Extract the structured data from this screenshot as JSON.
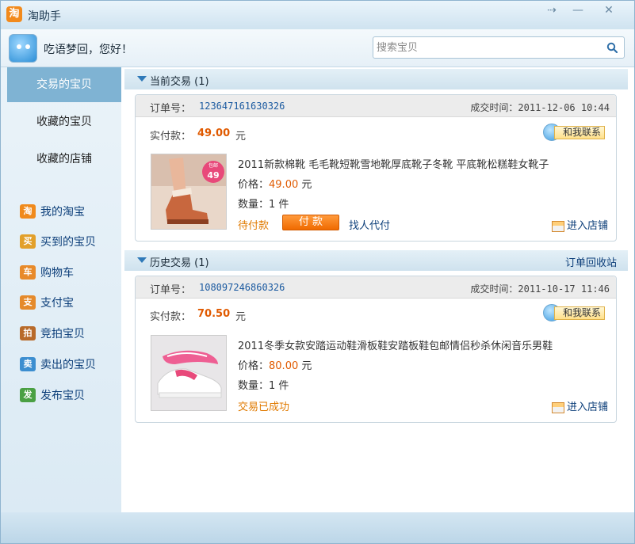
{
  "window": {
    "title": "淘助手",
    "logo_char": "淘",
    "pin_glyph": "⇢",
    "min_glyph": "—",
    "close_glyph": "✕"
  },
  "user": {
    "greeting": "吃语梦回，您好！"
  },
  "search": {
    "placeholder": "搜索宝贝"
  },
  "sidebar": {
    "tabs": [
      {
        "label": "交易的宝贝",
        "active": true
      },
      {
        "label": "收藏的宝贝",
        "active": false
      },
      {
        "label": "收藏的店铺",
        "active": false
      }
    ],
    "links": [
      {
        "label": "我的淘宝",
        "icon": "taobao-icon",
        "glyph": "淘",
        "color": "#f08a1c"
      },
      {
        "label": "买到的宝贝",
        "icon": "bought-items-icon",
        "glyph": "买",
        "color": "#e2a02a"
      },
      {
        "label": "购物车",
        "icon": "cart-icon",
        "glyph": "车",
        "color": "#e88a2a"
      },
      {
        "label": "支付宝",
        "icon": "alipay-icon",
        "glyph": "支",
        "color": "#e58a2b"
      },
      {
        "label": "竞拍宝贝",
        "icon": "auction-icon",
        "glyph": "拍",
        "color": "#b86a2a"
      },
      {
        "label": "卖出的宝贝",
        "icon": "sold-items-icon",
        "glyph": "卖",
        "color": "#3c8ed0"
      },
      {
        "label": "发布宝贝",
        "icon": "publish-icon",
        "glyph": "发",
        "color": "#4aa043"
      }
    ]
  },
  "labels": {
    "order_no": "订单号：",
    "deal_time": "成交时间：",
    "paid": "实付款：",
    "yuan": "元",
    "price": "价格：",
    "qty": "数量：",
    "contact": "和我联系",
    "enter_shop": "进入店铺"
  },
  "current": {
    "header": "当前交易 (1)",
    "order": {
      "order_no": "123647161630326",
      "time": "2011-12-06 10:44",
      "paid": "49.00",
      "title": "2011新款棉靴 毛毛靴短靴雪地靴厚底靴子冬靴 平底靴松糕鞋女靴子",
      "price": "49.00",
      "price_unit": " 元",
      "qty": "1 件",
      "status": "待付款",
      "pay_label": "付 款",
      "proxy_label": "找人代付",
      "thumb_badge": "49",
      "thumb_badge_top": "包邮"
    }
  },
  "history": {
    "header": "历史交易 (1)",
    "recycle_link": "订单回收站",
    "order": {
      "order_no": "108097246860326",
      "time": "2011-10-17 11:46",
      "paid": "70.50",
      "title": "2011冬季女款安踏运动鞋滑板鞋安踏板鞋包邮情侣秒杀休闲音乐男鞋",
      "price": "80.00",
      "price_unit": " 元",
      "qty": "1 件",
      "status": "交易已成功"
    }
  }
}
